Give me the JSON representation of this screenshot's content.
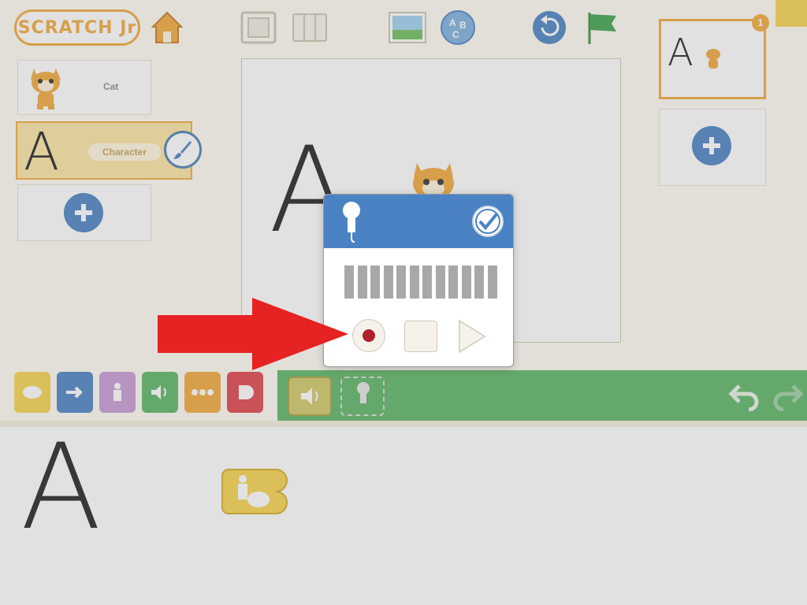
{
  "app": {
    "logo_text": "SCRATCH Jr"
  },
  "toolbar": {
    "home_icon": "home-icon",
    "fullscreen_icon": "fullscreen-icon",
    "grid_icon": "grid-icon",
    "background_icon": "background-icon",
    "text_icon": "text-icon",
    "reset_icon": "reset-icon",
    "green_flag_icon": "green-flag-icon"
  },
  "sprites": [
    {
      "name": "Cat",
      "selected": false
    },
    {
      "name": "Character",
      "selected": true,
      "thumb_glyph": "A"
    }
  ],
  "pages": {
    "current_number": "1",
    "thumb_glyph": "A"
  },
  "stage": {
    "char_glyph": "A"
  },
  "palette": {
    "categories": [
      {
        "name": "triggering",
        "color": "#f7d44e"
      },
      {
        "name": "motion",
        "color": "#4a82c3"
      },
      {
        "name": "looks",
        "color": "#c79bd6"
      },
      {
        "name": "sound",
        "color": "#5cb464"
      },
      {
        "name": "control",
        "color": "#f2a93b"
      },
      {
        "name": "end",
        "color": "#e0424a"
      }
    ],
    "block_bar_color": "#5cb464"
  },
  "script": {
    "char_glyph": "A"
  },
  "dialog": {
    "header_color": "#4a82c3",
    "meter_bars": 12,
    "record_color": "#b21f2d"
  },
  "pointer_arrow_color": "#e62222"
}
